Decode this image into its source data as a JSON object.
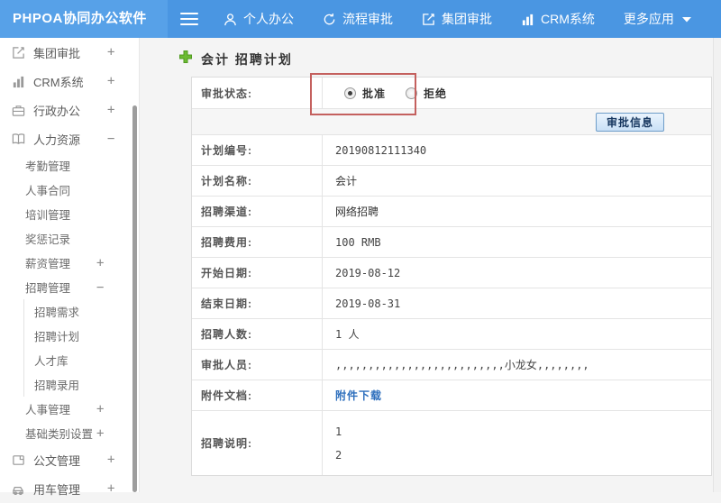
{
  "app": {
    "title": "PHPOA协同办公软件"
  },
  "colors": {
    "topbar": "#4a96e2",
    "logo_bg": "#57a1e8",
    "link": "#2e6fbd",
    "highlight_box": "#c4605e",
    "button_face": "#c9e0f6"
  },
  "topnav": {
    "items": [
      {
        "label": "个人办公",
        "icon": "user-icon"
      },
      {
        "label": "流程审批",
        "icon": "process-refresh-icon"
      },
      {
        "label": "集团审批",
        "icon": "edit-square-icon"
      },
      {
        "label": "CRM系统",
        "icon": "bar-chart-icon"
      },
      {
        "label": "更多应用",
        "icon": "caret-down-icon"
      }
    ]
  },
  "sidebar": {
    "items": [
      {
        "label": "集团审批",
        "expand": "+"
      },
      {
        "label": "CRM系统",
        "expand": "+"
      },
      {
        "label": "行政办公",
        "expand": "+"
      },
      {
        "label": "人力资源",
        "expand": "−"
      },
      {
        "label": "考勤管理",
        "expand": ""
      },
      {
        "label": "人事合同",
        "expand": ""
      },
      {
        "label": "培训管理",
        "expand": ""
      },
      {
        "label": "奖惩记录",
        "expand": ""
      },
      {
        "label": "薪资管理",
        "expand": "+"
      },
      {
        "label": "招聘管理",
        "expand": "−"
      },
      {
        "label": "招聘需求",
        "expand": ""
      },
      {
        "label": "招聘计划",
        "expand": ""
      },
      {
        "label": "人才库",
        "expand": ""
      },
      {
        "label": "招聘录用",
        "expand": ""
      },
      {
        "label": "人事管理",
        "expand": "+"
      },
      {
        "label": "基础类别设置",
        "expand": "+"
      },
      {
        "label": "公文管理",
        "expand": "+"
      },
      {
        "label": "用车管理",
        "expand": "+"
      }
    ]
  },
  "breadcrumb": {
    "title": "会计 招聘计划"
  },
  "panel": {
    "status_label": "审批状态:",
    "radios": [
      {
        "label": "批准",
        "checked": true
      },
      {
        "label": "拒绝",
        "checked": false
      }
    ],
    "action_button": "审批信息",
    "rows": [
      {
        "label": "计划编号:",
        "value": "20190812111340"
      },
      {
        "label": "计划名称:",
        "value": "会计"
      },
      {
        "label": "招聘渠道:",
        "value": "网络招聘"
      },
      {
        "label": "招聘费用:",
        "value": "100 RMB"
      },
      {
        "label": "开始日期:",
        "value": "2019-08-12"
      },
      {
        "label": "结束日期:",
        "value": "2019-08-31"
      },
      {
        "label": "招聘人数:",
        "value": "1 人"
      },
      {
        "label": "审批人员:",
        "value": ",,,,,,,,,,,,,,,,,,,,,,,,,,小龙女,,,,,,,,"
      },
      {
        "label": "附件文档:",
        "value": "附件下载"
      },
      {
        "label": "招聘说明:",
        "lines": [
          "1",
          "2"
        ]
      }
    ]
  }
}
